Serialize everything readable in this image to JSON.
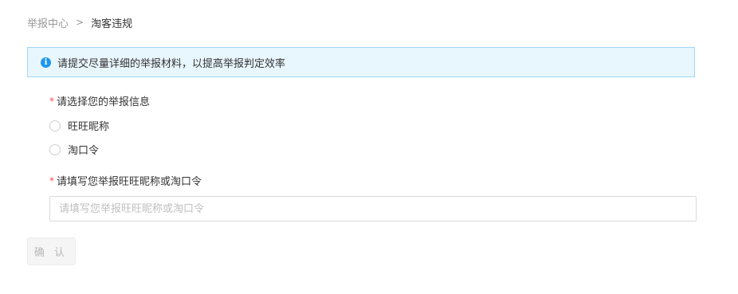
{
  "breadcrumb": {
    "parent": "举报中心",
    "separator": ">",
    "current": "淘客违规"
  },
  "alert": {
    "icon": "info-icon",
    "text": "请提交尽量详细的举报材料，以提高举报判定效率"
  },
  "form": {
    "info_type": {
      "required_mark": "*",
      "label": "请选择您的举报信息",
      "options": [
        {
          "label": "旺旺昵称",
          "selected": false
        },
        {
          "label": "淘口令",
          "selected": false
        }
      ]
    },
    "report_target": {
      "required_mark": "*",
      "label": "请填写您举报旺旺昵称或淘口令",
      "placeholder": "请填写您举报旺旺昵称或淘口令",
      "value": ""
    },
    "confirm_label": "确 认"
  },
  "colors": {
    "accent": "#1e96f0",
    "alert_bg": "#e8f6fe",
    "alert_border": "#9fd8f6",
    "required": "#ff4d4f",
    "disabled_text": "#b8b8b8"
  }
}
